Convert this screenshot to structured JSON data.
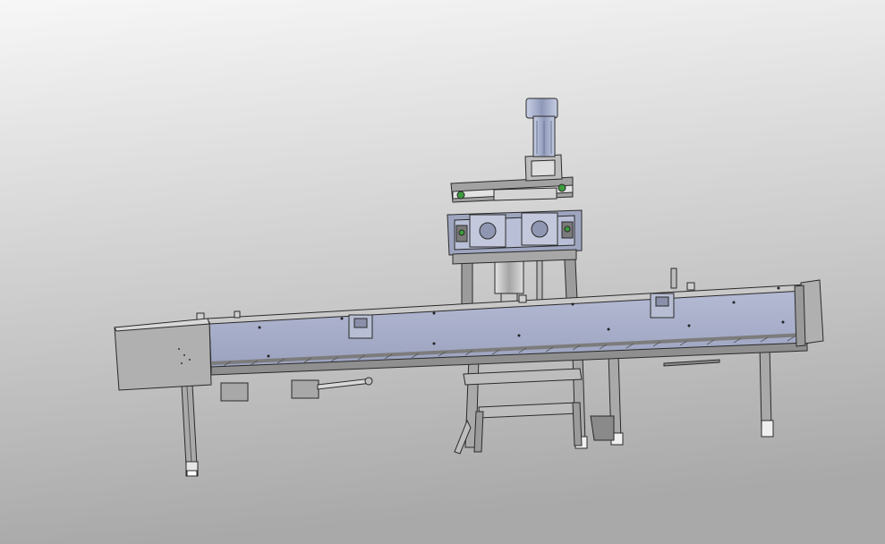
{
  "viewport": {
    "background_top": "#f7f7f7",
    "background_bottom": "#a9a9a9"
  },
  "model": {
    "conveyor_face_color": "#a7adc8",
    "end_cap_color": "#b0b0b0",
    "frame_color": "#8d8d8d",
    "motor_color": "#9aa5c3",
    "outline_color": "#2a2a2a",
    "accent_green": "#3d9a3d"
  }
}
